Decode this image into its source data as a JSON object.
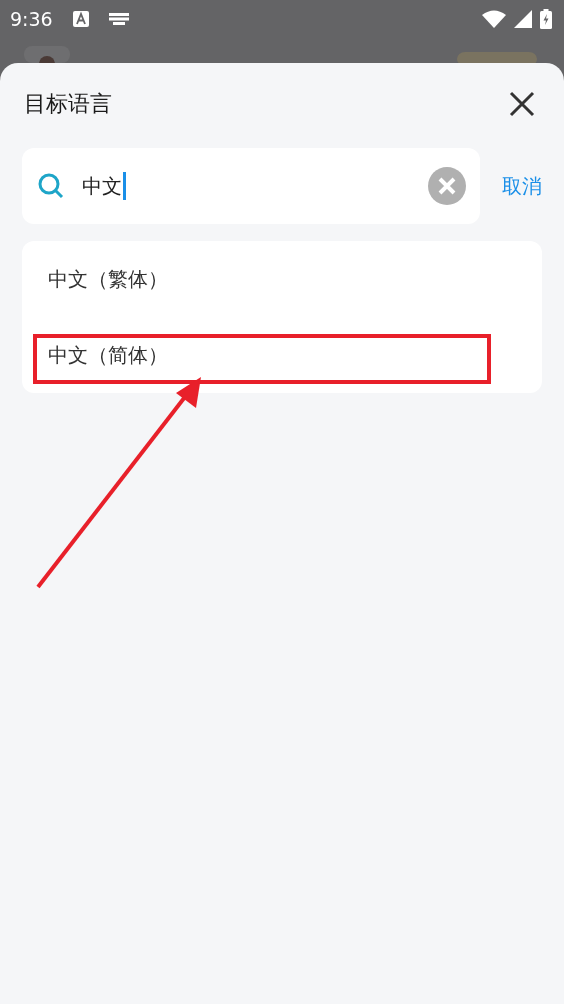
{
  "status_bar": {
    "time": "9:36"
  },
  "sheet": {
    "title": "目标语言"
  },
  "search": {
    "value": "中文",
    "cancel": "取消"
  },
  "results": [
    {
      "label": "中文（繁体）",
      "highlighted": false
    },
    {
      "label": "中文（简体）",
      "highlighted": true
    }
  ]
}
